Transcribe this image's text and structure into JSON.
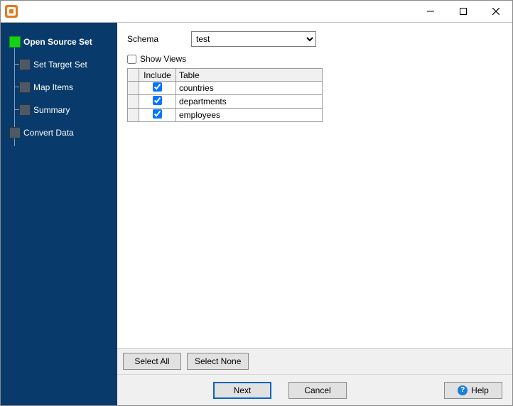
{
  "titlebar": {
    "title": ""
  },
  "sidebar": {
    "steps": [
      {
        "label": "Open Source Set",
        "active": true,
        "sub": false
      },
      {
        "label": "Set Target Set",
        "active": false,
        "sub": true
      },
      {
        "label": "Map Items",
        "active": false,
        "sub": true
      },
      {
        "label": "Summary",
        "active": false,
        "sub": true
      },
      {
        "label": "Convert Data",
        "active": false,
        "sub": false
      }
    ]
  },
  "form": {
    "schema_label": "Schema",
    "schema_value": "test",
    "show_views_label": "Show Views",
    "show_views_checked": false
  },
  "grid": {
    "headers": {
      "include": "Include",
      "table": "Table"
    },
    "rows": [
      {
        "include": true,
        "table": "countries"
      },
      {
        "include": true,
        "table": "departments"
      },
      {
        "include": true,
        "table": "employees"
      }
    ]
  },
  "buttons": {
    "select_all": "Select All",
    "select_none": "Select None",
    "next": "Next",
    "cancel": "Cancel",
    "help": "Help"
  }
}
